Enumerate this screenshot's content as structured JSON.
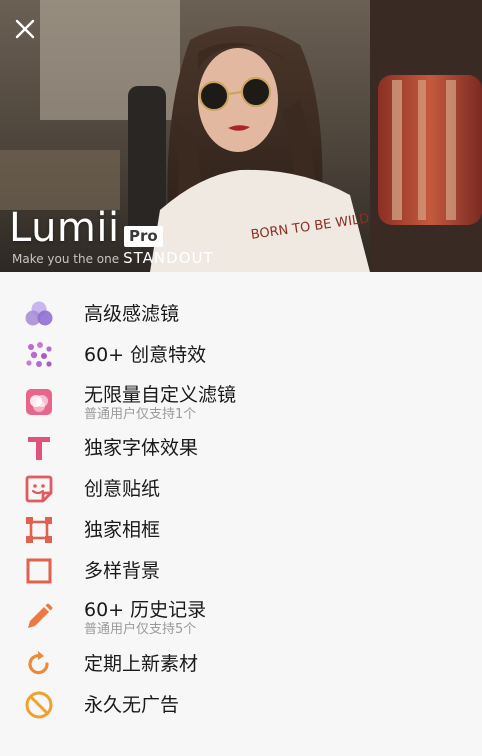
{
  "header": {
    "brand": "Lumii",
    "badge": "Pro",
    "tagline_prefix": "Make you the one",
    "tagline_emphasis": "STANDOUT",
    "shirt_text": "BORN TO BE WILD"
  },
  "features": [
    {
      "label": "高级感滤镜",
      "sub": "",
      "icon": "filter-circles-icon",
      "color": "#a98ed6"
    },
    {
      "label": "60+ 创意特效",
      "sub": "",
      "icon": "sparkle-dots-icon",
      "color": "#b86ad0"
    },
    {
      "label": "无限量自定义滤镜",
      "sub": "普通用户仅支持1个",
      "icon": "custom-filter-icon",
      "color": "#e0547b"
    },
    {
      "label": "独家字体效果",
      "sub": "",
      "icon": "text-t-icon",
      "color": "#e0547b"
    },
    {
      "label": "创意贴纸",
      "sub": "",
      "icon": "sticker-icon",
      "color": "#e05a62"
    },
    {
      "label": "独家相框",
      "sub": "",
      "icon": "frame-icon",
      "color": "#e0624c"
    },
    {
      "label": "多样背景",
      "sub": "",
      "icon": "background-square-icon",
      "color": "#e0624c"
    },
    {
      "label": "60+ 历史记录",
      "sub": "普通用户仅支持5个",
      "icon": "pencil-icon",
      "color": "#ec7a40"
    },
    {
      "label": "定期上新素材",
      "sub": "",
      "icon": "refresh-icon",
      "color": "#ef8a34"
    },
    {
      "label": "永久无广告",
      "sub": "",
      "icon": "no-ads-icon",
      "color": "#f0a030"
    }
  ]
}
